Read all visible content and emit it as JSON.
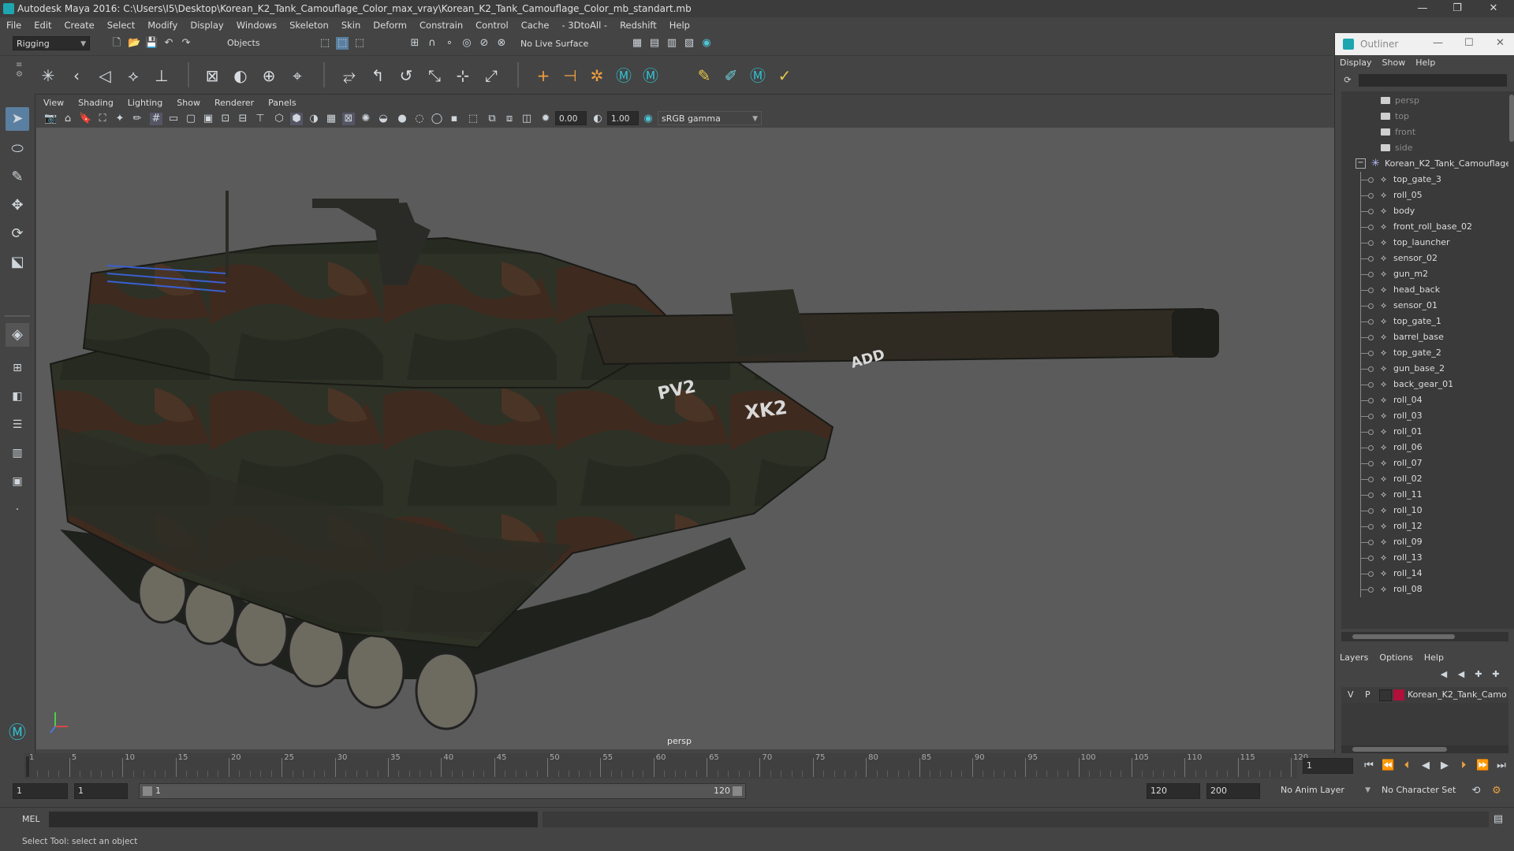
{
  "window": {
    "title": "Autodesk Maya 2016: C:\\Users\\I5\\Desktop\\Korean_K2_Tank_Camouflage_Color_max_vray\\Korean_K2_Tank_Camouflage_Color_mb_standart.mb",
    "minimize": "—",
    "maximize": "❐",
    "close": "✕"
  },
  "menubar": [
    "File",
    "Edit",
    "Create",
    "Select",
    "Modify",
    "Display",
    "Windows",
    "Skeleton",
    "Skin",
    "Deform",
    "Constrain",
    "Control",
    "Cache",
    "- 3DtoAll -",
    "Redshift",
    "Help"
  ],
  "statusline": {
    "menuset": "Rigging",
    "selection_mode": "Objects",
    "live_surface": "No Live Surface"
  },
  "panel": {
    "menu": [
      "View",
      "Shading",
      "Lighting",
      "Show",
      "Renderer",
      "Panels"
    ],
    "exposure": "0.00",
    "gamma": "1.00",
    "color_space": "sRGB gamma",
    "camera_label": "persp"
  },
  "outliner": {
    "title": "Outliner",
    "menu": [
      "Display",
      "Show",
      "Help"
    ],
    "cameras": [
      "persp",
      "top",
      "front",
      "side"
    ],
    "root": "Korean_K2_Tank_Camouflage",
    "children": [
      "top_gate_3",
      "roll_05",
      "body",
      "front_roll_base_02",
      "top_launcher",
      "sensor_02",
      "gun_m2",
      "head_back",
      "sensor_01",
      "top_gate_1",
      "barrel_base",
      "top_gate_2",
      "gun_base_2",
      "back_gear_01",
      "roll_04",
      "roll_03",
      "roll_01",
      "roll_06",
      "roll_07",
      "roll_02",
      "roll_11",
      "roll_10",
      "roll_12",
      "roll_09",
      "roll_13",
      "roll_14",
      "roll_08"
    ]
  },
  "layers": {
    "menu": [
      "Layers",
      "Options",
      "Help"
    ],
    "row": {
      "v": "V",
      "p": "P",
      "name": "Korean_K2_Tank_Camo",
      "color": "#b0103a"
    }
  },
  "timeline": {
    "ticks": [
      "1",
      "5",
      "10",
      "15",
      "20",
      "25",
      "30",
      "35",
      "40",
      "45",
      "50",
      "55",
      "60",
      "65",
      "70",
      "75",
      "80",
      "85",
      "90",
      "95",
      "100",
      "105",
      "110",
      "115",
      "120"
    ],
    "current_frame": "1"
  },
  "range": {
    "start": "1",
    "anim_start": "1",
    "slider_start": "1",
    "slider_end": "120",
    "end": "120",
    "anim_end": "200",
    "anim_layer": "No Anim Layer",
    "character_set": "No Character Set"
  },
  "cmdline": {
    "label": "MEL"
  },
  "helpline": {
    "text": "Select Tool: select an object"
  },
  "tank": {
    "decal_1": "PV2",
    "decal_2": "XK2",
    "decal_3": "ADD"
  },
  "colors": {
    "accent": "#5a7fa0",
    "maya_teal": "#1ea6b0",
    "viewport_bg": "#5b5b5b"
  }
}
